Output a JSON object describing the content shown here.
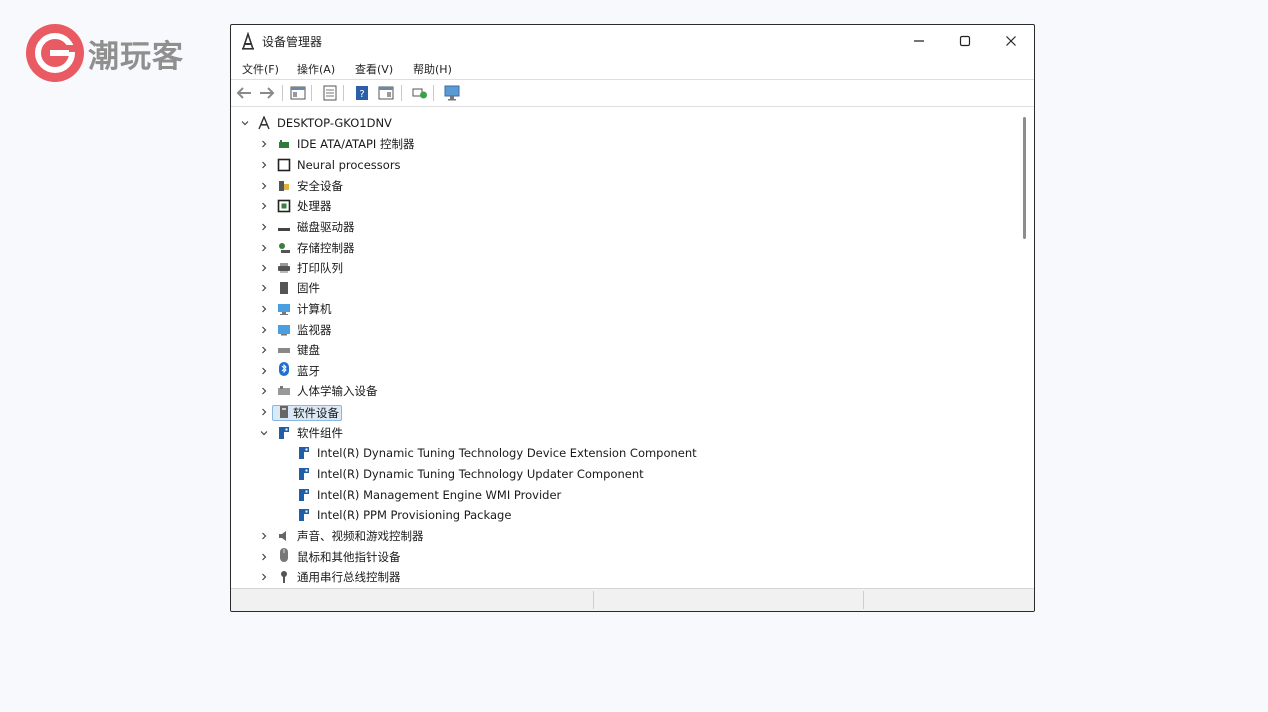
{
  "watermark": {
    "text": "潮玩客",
    "accent": "#e95a63"
  },
  "window": {
    "title": "设备管理器"
  },
  "menu": [
    {
      "label": "文件(F)"
    },
    {
      "label": "操作(A)"
    },
    {
      "label": "查看(V)"
    },
    {
      "label": "帮助(H)"
    }
  ],
  "toolbar": [
    {
      "icon": "back-arrow-icon"
    },
    {
      "icon": "forward-arrow-icon"
    },
    {
      "icon": "show-hide-console-tree-icon"
    },
    {
      "icon": "properties-icon"
    },
    {
      "icon": "help-icon"
    },
    {
      "icon": "view-icon"
    },
    {
      "icon": "scan-hardware-icon"
    },
    {
      "icon": "monitor-icon"
    }
  ],
  "tree": {
    "root": {
      "label": "DESKTOP-GKO1DNV",
      "icon": "computer-root-icon",
      "expanded": true
    },
    "items": [
      {
        "label": "IDE ATA/ATAPI 控制器",
        "icon": "ide-controller-icon",
        "expanded": false
      },
      {
        "label": "Neural processors",
        "icon": "neural-processor-icon",
        "expanded": false
      },
      {
        "label": "安全设备",
        "icon": "security-device-icon",
        "expanded": false
      },
      {
        "label": "处理器",
        "icon": "processor-icon",
        "expanded": false
      },
      {
        "label": "磁盘驱动器",
        "icon": "disk-drive-icon",
        "expanded": false
      },
      {
        "label": "存储控制器",
        "icon": "storage-controller-icon",
        "expanded": false
      },
      {
        "label": "打印队列",
        "icon": "printer-icon",
        "expanded": false
      },
      {
        "label": "固件",
        "icon": "firmware-icon",
        "expanded": false
      },
      {
        "label": "计算机",
        "icon": "computer-icon",
        "expanded": false
      },
      {
        "label": "监视器",
        "icon": "monitor-icon",
        "expanded": false
      },
      {
        "label": "键盘",
        "icon": "keyboard-icon",
        "expanded": false
      },
      {
        "label": "蓝牙",
        "icon": "bluetooth-icon",
        "expanded": false
      },
      {
        "label": "人体学输入设备",
        "icon": "hid-icon",
        "expanded": false
      },
      {
        "label": "软件设备",
        "icon": "software-device-icon",
        "expanded": false,
        "selected": true
      },
      {
        "label": "软件组件",
        "icon": "software-component-icon",
        "expanded": true,
        "children": [
          {
            "label": "Intel(R) Dynamic Tuning Technology Device Extension Component",
            "icon": "software-component-icon"
          },
          {
            "label": "Intel(R) Dynamic Tuning Technology Updater Component",
            "icon": "software-component-icon"
          },
          {
            "label": "Intel(R) Management Engine WMI Provider",
            "icon": "software-component-icon"
          },
          {
            "label": "Intel(R) PPM Provisioning Package",
            "icon": "software-component-icon"
          }
        ]
      },
      {
        "label": "声音、视频和游戏控制器",
        "icon": "sound-icon",
        "expanded": false
      },
      {
        "label": "鼠标和其他指针设备",
        "icon": "mouse-icon",
        "expanded": false
      },
      {
        "label": "通用串行总线控制器",
        "icon": "usb-icon",
        "expanded": false
      }
    ]
  }
}
